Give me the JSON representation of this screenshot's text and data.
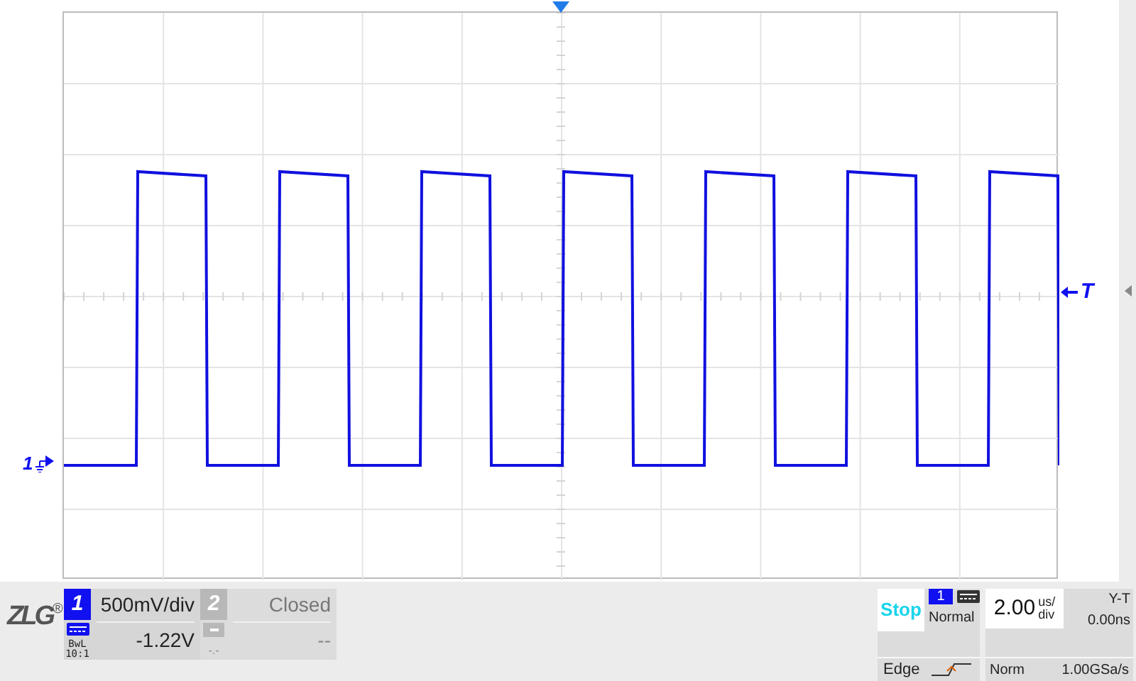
{
  "channel_marker": {
    "label": "1"
  },
  "trigger_marker": {
    "label": "T"
  },
  "logo": {
    "text": "ZLG",
    "mark": "®"
  },
  "channels": [
    {
      "number": "1",
      "selected": true,
      "scale": "500mV/div",
      "offset": "-1.22V",
      "probe": "BwL",
      "ratio": "10:1"
    },
    {
      "number": "2",
      "selected": false,
      "scale": "Closed",
      "offset": "--",
      "probe": "-.-"
    }
  ],
  "trigger": {
    "run_state": "Stop",
    "source": "1",
    "mode": "Normal",
    "type": "Edge"
  },
  "timebase": {
    "value": "2.00",
    "unit_top": "us/",
    "unit_bottom": "div",
    "time_mode": "Y-T",
    "delay": "0.00ns",
    "acquisition": "Norm",
    "sample_rate": "1.00GSa/s"
  }
}
